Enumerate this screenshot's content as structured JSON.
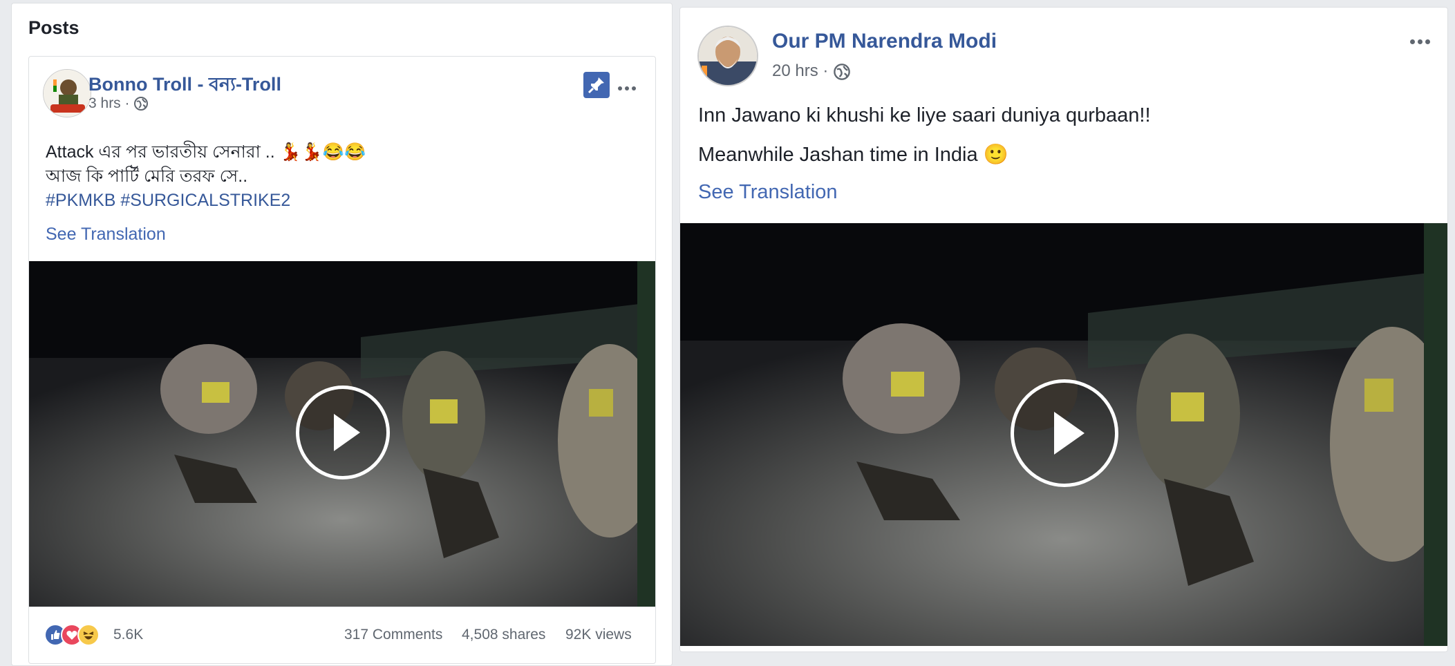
{
  "left_section": {
    "title": "Posts",
    "post": {
      "page_name": "Bonno Troll - বন্য-Troll",
      "time": "3 hrs ·",
      "text_line1": "Attack এর পর ভারতীয় সেনারা .. 💃💃😂😂",
      "text_line2": "আজ কি পার্টি মেরি তরফ সে..",
      "hashtags": "#PKMKB #SURGICALSTRIKE2",
      "see_translation": "See Translation",
      "reaction_count": "5.6K",
      "comments": "317 Comments",
      "shares": "4,508 shares",
      "views": "92K views",
      "icons": [
        "pin-icon",
        "more-options-icon",
        "globe-icon",
        "play-icon",
        "like-reaction-icon",
        "love-reaction-icon",
        "haha-reaction-icon"
      ]
    }
  },
  "right_post": {
    "page_name": "Our PM Narendra Modi",
    "time": "20 hrs ·",
    "text_line1": "Inn Jawano ki khushi ke liye saari duniya qurbaan!!",
    "text_line2": "Meanwhile Jashan time in India 🙂",
    "see_translation": "See Translation",
    "icons": [
      "more-options-icon",
      "globe-icon",
      "play-icon"
    ]
  },
  "colors": {
    "link_blue": "#365899",
    "accent_blue": "#4267b2",
    "background": "#e9ebee",
    "meta_gray": "#616770"
  }
}
